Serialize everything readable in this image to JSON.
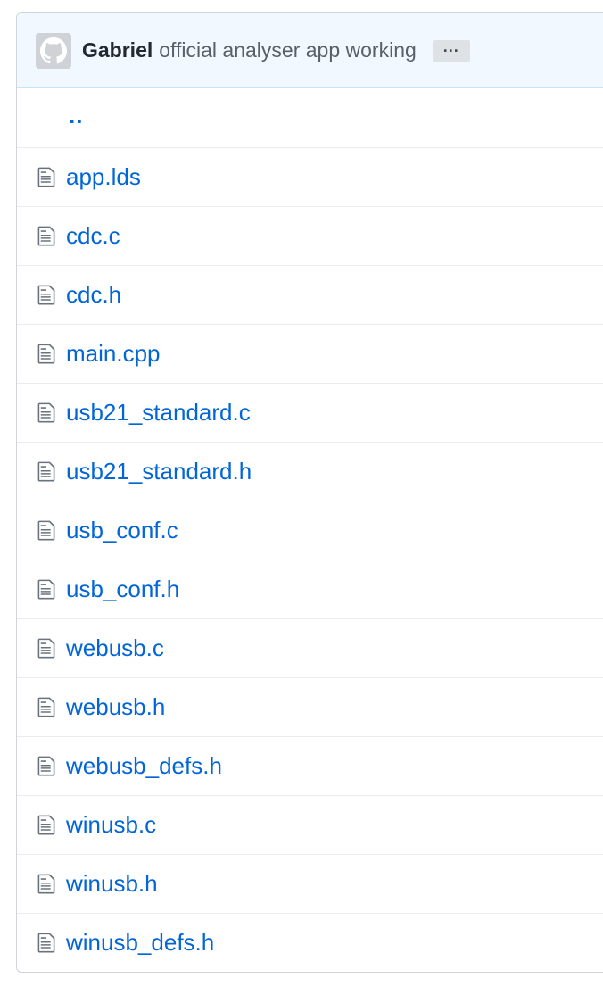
{
  "commit": {
    "author": "Gabriel",
    "message": "official analyser app working",
    "more_label": "···",
    "avatar_icon": "github-octocat-icon"
  },
  "parent_dir": {
    "label": ".."
  },
  "files": [
    {
      "name": "app.lds",
      "icon": "file-icon"
    },
    {
      "name": "cdc.c",
      "icon": "file-icon"
    },
    {
      "name": "cdc.h",
      "icon": "file-icon"
    },
    {
      "name": "main.cpp",
      "icon": "file-icon"
    },
    {
      "name": "usb21_standard.c",
      "icon": "file-icon"
    },
    {
      "name": "usb21_standard.h",
      "icon": "file-icon"
    },
    {
      "name": "usb_conf.c",
      "icon": "file-icon"
    },
    {
      "name": "usb_conf.h",
      "icon": "file-icon"
    },
    {
      "name": "webusb.c",
      "icon": "file-icon"
    },
    {
      "name": "webusb.h",
      "icon": "file-icon"
    },
    {
      "name": "webusb_defs.h",
      "icon": "file-icon"
    },
    {
      "name": "winusb.c",
      "icon": "file-icon"
    },
    {
      "name": "winusb.h",
      "icon": "file-icon"
    },
    {
      "name": "winusb_defs.h",
      "icon": "file-icon"
    }
  ],
  "colors": {
    "link": "#0366d6",
    "header_bg": "#f1f8ff",
    "border": "#d1d5da"
  }
}
